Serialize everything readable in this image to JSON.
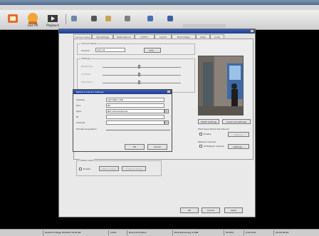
{
  "app": {
    "title_text": "",
    "toolbar": {
      "buttons": [
        {
          "name": "toolbar-button-1",
          "label": ""
        },
        {
          "name": "toolbar-button-2",
          "label": "Live PR"
        },
        {
          "name": "toolbar-button-3",
          "label": "Playback"
        }
      ]
    }
  },
  "dialog": {
    "title": "",
    "tabs": [
      {
        "label": "Camera Setup"
      },
      {
        "label": "Cfg settings"
      },
      {
        "label": "Media Record"
      },
      {
        "label": "I/O/Frm"
      },
      {
        "label": "Cam/V"
      },
      {
        "label": "Multi-Viewer"
      },
      {
        "label": "Video"
      },
      {
        "label": "Audio"
      }
    ],
    "camera_group_label": "Camera Setup",
    "camera_label": "Camera",
    "camera_value": "Cam 01",
    "camera_button": "Edit...",
    "settings_label": "Settings",
    "slider_labels": [
      "Brightness",
      "Contrast",
      "Saturation"
    ],
    "start_settings": "START Settings",
    "advanced_settings": "Advanced Settings",
    "point_event_label": "Point Save Event Set Interval",
    "enable_label": "Enable",
    "options_button": "Options",
    "network_camera_label": "Network Camera",
    "ip_network_camera_label": "IP Network Camera",
    "ip_settings_button": "Settings...",
    "motion_group_label": "Motion Alert",
    "motion_enable": "Enable",
    "motion_btn1": "Motion Setup",
    "motion_btn2": "Schedule Setup",
    "ok": "OK",
    "cancel": "Cancel",
    "apply": "Apply"
  },
  "subdialog": {
    "title": "Network Camera Settings",
    "fields": [
      {
        "label": "Address",
        "value": "192.168.1.100"
      },
      {
        "label": "Port",
        "value": "80"
      },
      {
        "label": "Type",
        "value": "Net Camera/Server"
      },
      {
        "label": "ID",
        "value": ""
      },
      {
        "label": "Channel",
        "value": ""
      }
    ],
    "full_res_label": "Full Res Acquisition",
    "ok": "OK",
    "cancel": "Cancel"
  },
  "statusbar": {
    "cells": [
      "Global Footage 2013/09 16:02:08",
      "100%",
      "Disk Information",
      "Disk Remaining 0.0GB",
      "00.00%",
      "0:00.0.00",
      "00:00 00:00"
    ]
  },
  "colors": {
    "title_blue": "#1f3f8c",
    "window_bg": "#e9e9e9"
  }
}
